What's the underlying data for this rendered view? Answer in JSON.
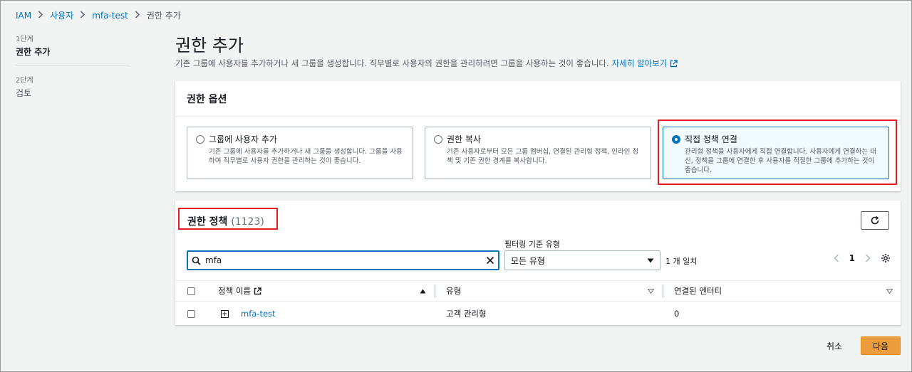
{
  "breadcrumb": {
    "item1": "IAM",
    "item2": "사용자",
    "item3": "mfa-test",
    "current": "권한 추가"
  },
  "steps": [
    {
      "num": "1단계",
      "label": "권한 추가"
    },
    {
      "num": "2단계",
      "label": "검토"
    }
  ],
  "page": {
    "title": "권한 추가",
    "description": "기존 그룹에 사용자를 추가하거나 새 그룹을 생성합니다. 직무별로 사용자의 권한을 관리하려면 그룹을 사용하는 것이 좋습니다.",
    "learn_more": "자세히 알아보기"
  },
  "permission_options": {
    "heading": "권한 옵션",
    "options": [
      {
        "title": "그룹에 사용자 추가",
        "desc": "기존 그룹에 사용자를 추가하거나 새 그룹을 생성합니다. 그룹을 사용하여 직무별로 사용자 권한을 관리하는 것이 좋습니다."
      },
      {
        "title": "권한 복사",
        "desc": "기존 사용자로부터 모든 그룹 멤버십, 연결된 관리형 정책, 인라인 정책 및 기존 권한 경계를 복사합니다."
      },
      {
        "title": "직접 정책 연결",
        "desc": "관리형 정책을 사용자에게 직접 연결합니다. 사용자에게 연결하는 대신, 정책을 그룹에 연결한 후 사용자를 적절한 그룹에 추가하는 것이 좋습니다.",
        "selected": true
      }
    ]
  },
  "policies": {
    "heading": "권한 정책",
    "count": "(1123)",
    "filter_label": "필터링 기준 유형",
    "search_value": "mfa",
    "type_select": "모든 유형",
    "match_text": "1 개 일치",
    "page_num": "1",
    "columns": {
      "name": "정책 이름",
      "type": "유형",
      "entities": "연결된 엔터티"
    },
    "rows": [
      {
        "name": "mfa-test",
        "type": "고객 관리형",
        "entities": "0"
      }
    ]
  },
  "footer": {
    "cancel": "취소",
    "next": "다음"
  },
  "colors": {
    "accent": "#0073bb",
    "primary_button": "#ec9d3e",
    "highlight": "#e31b23"
  }
}
